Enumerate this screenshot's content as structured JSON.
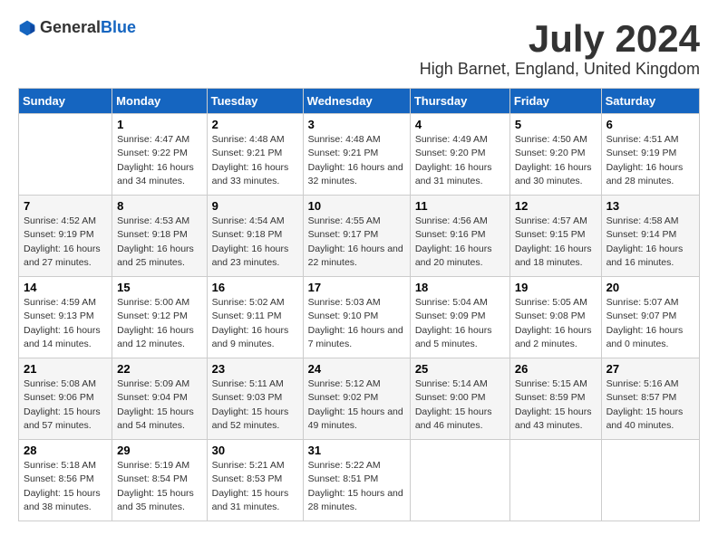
{
  "header": {
    "logo_general": "General",
    "logo_blue": "Blue",
    "month_title": "July 2024",
    "location": "High Barnet, England, United Kingdom"
  },
  "days_of_week": [
    "Sunday",
    "Monday",
    "Tuesday",
    "Wednesday",
    "Thursday",
    "Friday",
    "Saturday"
  ],
  "weeks": [
    [
      {
        "day": "",
        "sunrise": "",
        "sunset": "",
        "daylight": ""
      },
      {
        "day": "1",
        "sunrise": "Sunrise: 4:47 AM",
        "sunset": "Sunset: 9:22 PM",
        "daylight": "Daylight: 16 hours and 34 minutes."
      },
      {
        "day": "2",
        "sunrise": "Sunrise: 4:48 AM",
        "sunset": "Sunset: 9:21 PM",
        "daylight": "Daylight: 16 hours and 33 minutes."
      },
      {
        "day": "3",
        "sunrise": "Sunrise: 4:48 AM",
        "sunset": "Sunset: 9:21 PM",
        "daylight": "Daylight: 16 hours and 32 minutes."
      },
      {
        "day": "4",
        "sunrise": "Sunrise: 4:49 AM",
        "sunset": "Sunset: 9:20 PM",
        "daylight": "Daylight: 16 hours and 31 minutes."
      },
      {
        "day": "5",
        "sunrise": "Sunrise: 4:50 AM",
        "sunset": "Sunset: 9:20 PM",
        "daylight": "Daylight: 16 hours and 30 minutes."
      },
      {
        "day": "6",
        "sunrise": "Sunrise: 4:51 AM",
        "sunset": "Sunset: 9:19 PM",
        "daylight": "Daylight: 16 hours and 28 minutes."
      }
    ],
    [
      {
        "day": "7",
        "sunrise": "Sunrise: 4:52 AM",
        "sunset": "Sunset: 9:19 PM",
        "daylight": "Daylight: 16 hours and 27 minutes."
      },
      {
        "day": "8",
        "sunrise": "Sunrise: 4:53 AM",
        "sunset": "Sunset: 9:18 PM",
        "daylight": "Daylight: 16 hours and 25 minutes."
      },
      {
        "day": "9",
        "sunrise": "Sunrise: 4:54 AM",
        "sunset": "Sunset: 9:18 PM",
        "daylight": "Daylight: 16 hours and 23 minutes."
      },
      {
        "day": "10",
        "sunrise": "Sunrise: 4:55 AM",
        "sunset": "Sunset: 9:17 PM",
        "daylight": "Daylight: 16 hours and 22 minutes."
      },
      {
        "day": "11",
        "sunrise": "Sunrise: 4:56 AM",
        "sunset": "Sunset: 9:16 PM",
        "daylight": "Daylight: 16 hours and 20 minutes."
      },
      {
        "day": "12",
        "sunrise": "Sunrise: 4:57 AM",
        "sunset": "Sunset: 9:15 PM",
        "daylight": "Daylight: 16 hours and 18 minutes."
      },
      {
        "day": "13",
        "sunrise": "Sunrise: 4:58 AM",
        "sunset": "Sunset: 9:14 PM",
        "daylight": "Daylight: 16 hours and 16 minutes."
      }
    ],
    [
      {
        "day": "14",
        "sunrise": "Sunrise: 4:59 AM",
        "sunset": "Sunset: 9:13 PM",
        "daylight": "Daylight: 16 hours and 14 minutes."
      },
      {
        "day": "15",
        "sunrise": "Sunrise: 5:00 AM",
        "sunset": "Sunset: 9:12 PM",
        "daylight": "Daylight: 16 hours and 12 minutes."
      },
      {
        "day": "16",
        "sunrise": "Sunrise: 5:02 AM",
        "sunset": "Sunset: 9:11 PM",
        "daylight": "Daylight: 16 hours and 9 minutes."
      },
      {
        "day": "17",
        "sunrise": "Sunrise: 5:03 AM",
        "sunset": "Sunset: 9:10 PM",
        "daylight": "Daylight: 16 hours and 7 minutes."
      },
      {
        "day": "18",
        "sunrise": "Sunrise: 5:04 AM",
        "sunset": "Sunset: 9:09 PM",
        "daylight": "Daylight: 16 hours and 5 minutes."
      },
      {
        "day": "19",
        "sunrise": "Sunrise: 5:05 AM",
        "sunset": "Sunset: 9:08 PM",
        "daylight": "Daylight: 16 hours and 2 minutes."
      },
      {
        "day": "20",
        "sunrise": "Sunrise: 5:07 AM",
        "sunset": "Sunset: 9:07 PM",
        "daylight": "Daylight: 16 hours and 0 minutes."
      }
    ],
    [
      {
        "day": "21",
        "sunrise": "Sunrise: 5:08 AM",
        "sunset": "Sunset: 9:06 PM",
        "daylight": "Daylight: 15 hours and 57 minutes."
      },
      {
        "day": "22",
        "sunrise": "Sunrise: 5:09 AM",
        "sunset": "Sunset: 9:04 PM",
        "daylight": "Daylight: 15 hours and 54 minutes."
      },
      {
        "day": "23",
        "sunrise": "Sunrise: 5:11 AM",
        "sunset": "Sunset: 9:03 PM",
        "daylight": "Daylight: 15 hours and 52 minutes."
      },
      {
        "day": "24",
        "sunrise": "Sunrise: 5:12 AM",
        "sunset": "Sunset: 9:02 PM",
        "daylight": "Daylight: 15 hours and 49 minutes."
      },
      {
        "day": "25",
        "sunrise": "Sunrise: 5:14 AM",
        "sunset": "Sunset: 9:00 PM",
        "daylight": "Daylight: 15 hours and 46 minutes."
      },
      {
        "day": "26",
        "sunrise": "Sunrise: 5:15 AM",
        "sunset": "Sunset: 8:59 PM",
        "daylight": "Daylight: 15 hours and 43 minutes."
      },
      {
        "day": "27",
        "sunrise": "Sunrise: 5:16 AM",
        "sunset": "Sunset: 8:57 PM",
        "daylight": "Daylight: 15 hours and 40 minutes."
      }
    ],
    [
      {
        "day": "28",
        "sunrise": "Sunrise: 5:18 AM",
        "sunset": "Sunset: 8:56 PM",
        "daylight": "Daylight: 15 hours and 38 minutes."
      },
      {
        "day": "29",
        "sunrise": "Sunrise: 5:19 AM",
        "sunset": "Sunset: 8:54 PM",
        "daylight": "Daylight: 15 hours and 35 minutes."
      },
      {
        "day": "30",
        "sunrise": "Sunrise: 5:21 AM",
        "sunset": "Sunset: 8:53 PM",
        "daylight": "Daylight: 15 hours and 31 minutes."
      },
      {
        "day": "31",
        "sunrise": "Sunrise: 5:22 AM",
        "sunset": "Sunset: 8:51 PM",
        "daylight": "Daylight: 15 hours and 28 minutes."
      },
      {
        "day": "",
        "sunrise": "",
        "sunset": "",
        "daylight": ""
      },
      {
        "day": "",
        "sunrise": "",
        "sunset": "",
        "daylight": ""
      },
      {
        "day": "",
        "sunrise": "",
        "sunset": "",
        "daylight": ""
      }
    ]
  ]
}
